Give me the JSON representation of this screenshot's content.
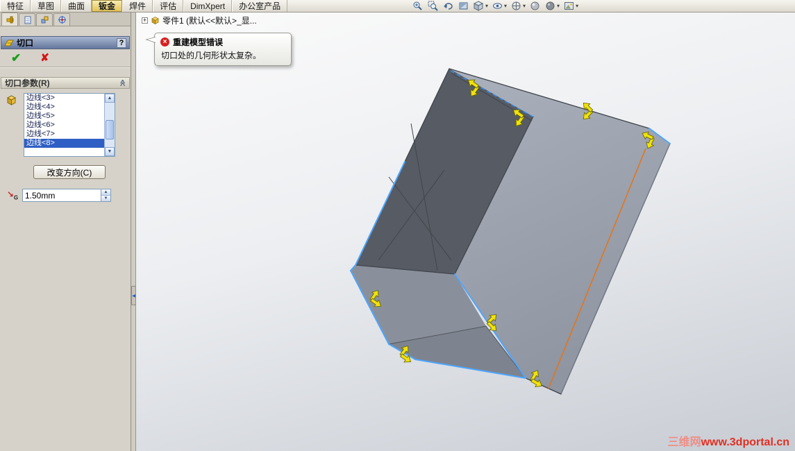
{
  "ribbon": {
    "tabs": [
      {
        "label": "特征"
      },
      {
        "label": "草图"
      },
      {
        "label": "曲面"
      },
      {
        "label": "钣金"
      },
      {
        "label": "焊件"
      },
      {
        "label": "评估"
      },
      {
        "label": "DimXpert"
      },
      {
        "label": "办公室产品"
      }
    ],
    "active_tab": "钣金",
    "view_toolbar_icons": [
      "zoom-in",
      "zoom-to-area",
      "previous-view",
      "section-view",
      "display-style",
      "hide-show-items",
      "view-orientation",
      "appearances",
      "apply-scene",
      "view-settings"
    ]
  },
  "feature_tree": {
    "expander": "+",
    "label": "零件1 (默认<<默认>_显..."
  },
  "error_balloon": {
    "icon": "error-circle-x",
    "icon_glyph": "×",
    "title": "重建模型错误",
    "message": "切口处的几何形状太复杂。"
  },
  "property_manager": {
    "title": "切口",
    "help_label": "?",
    "ok_glyph": "✔",
    "cancel_glyph": "✘",
    "group": {
      "header": "切口参数(R)",
      "edge_items": [
        "边线<3>",
        "边线<4>",
        "边线<5>",
        "边线<6>",
        "边线<7>",
        "边线<8>"
      ],
      "selected_item": "边线<8>",
      "change_direction_label": "改变方向(C)",
      "gap_value": "1.50mm"
    }
  },
  "watermark": {
    "prefix": "三维网",
    "url": "www.3dportal.cn"
  },
  "glyphs": {
    "caret": "▾",
    "up": "▲",
    "down": "▼",
    "double_chevron": "≪",
    "collapse_arrow": "◀"
  },
  "colors": {
    "selection_blue": "#2f5fc4",
    "edge_highlight": "#4da6ff",
    "bend_orange": "#e0761f",
    "arrow_yellow": "#f2e20c",
    "error_red": "#d62020",
    "active_tab_gold": "#e2c35e"
  }
}
